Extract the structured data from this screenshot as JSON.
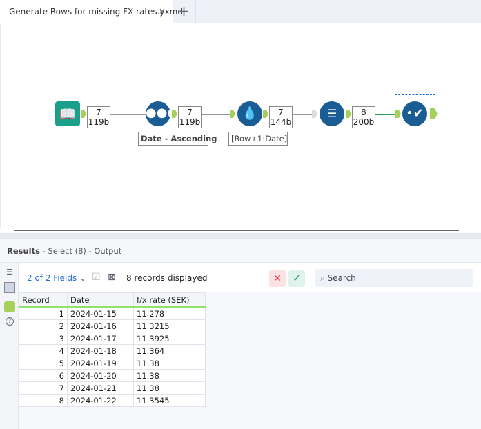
{
  "tabs": [
    {
      "label": "Generate Rows for missing FX rates.yxmd",
      "close": "×"
    }
  ],
  "new_tab": "+",
  "workflow": {
    "connections": [
      {
        "records": "7",
        "size": "119b"
      },
      {
        "records": "7",
        "size": "119b"
      },
      {
        "records": "7",
        "size": "144b"
      },
      {
        "records": "8",
        "size": "200b"
      }
    ],
    "annotations": {
      "sort": "Date - Ascending",
      "formula": "[Row+1:Date]"
    }
  },
  "results": {
    "title": "Results",
    "subtitle": "- Select (8) - Output",
    "fields_selector": "2 of 2 Fields",
    "records_displayed": "8 records displayed",
    "search_placeholder": "Search",
    "columns": [
      "Record",
      "Date",
      "f/x rate (SEK)"
    ],
    "rows": [
      [
        "1",
        "2024-01-15",
        "11.278"
      ],
      [
        "2",
        "2024-01-16",
        "11.3215"
      ],
      [
        "3",
        "2024-01-17",
        "11.3925"
      ],
      [
        "4",
        "2024-01-18",
        "11.364"
      ],
      [
        "5",
        "2024-01-19",
        "11.38"
      ],
      [
        "6",
        "2024-01-20",
        "11.38"
      ],
      [
        "7",
        "2024-01-21",
        "11.38"
      ],
      [
        "8",
        "2024-01-22",
        "11.3545"
      ]
    ]
  },
  "colors": {
    "tool_blue": "#1a5d94",
    "input_teal": "#1aa08a",
    "anchor_green": "#a6cf5b",
    "accent": "#1f6fd0"
  }
}
